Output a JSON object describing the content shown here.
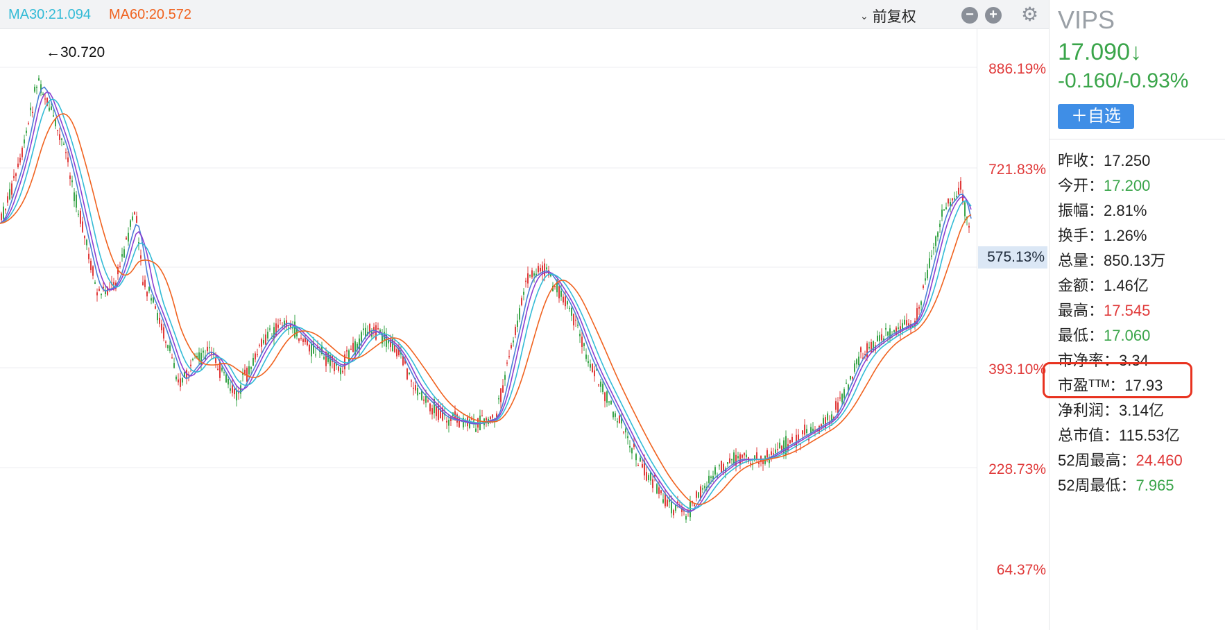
{
  "top_bar": {
    "ma30": "MA30:21.094",
    "ma60": "MA60:20.572",
    "adjust_label": "前复权",
    "chevron_icon": "chevron-down-icon",
    "buttons": [
      "minus-circle-icon",
      "plus-circle-icon",
      "minus-circle-icon",
      "gear-icon"
    ],
    "button_glyphs": {
      "minus": "−",
      "plus": "+"
    }
  },
  "chart": {
    "high_annotation": "←30.720",
    "y_axis_labels": [
      "886.19%",
      "721.83%",
      "393.10%",
      "228.73%",
      "64.37%"
    ],
    "current_tag": "575.13%",
    "colors": {
      "up": "#e03a3a",
      "down": "#3aa54a",
      "ma30": "#33bbd6",
      "ma60": "#f0621f",
      "ma_other1": "#8b3fd1",
      "ma_other2": "#4a7fd6"
    }
  },
  "sidebar": {
    "symbol": "VIPS",
    "price": "17.090↓",
    "change": "-0.160/-0.93%",
    "watch_button": "＋自选",
    "stats": [
      {
        "key": "昨收：",
        "value": "17.250",
        "tone": ""
      },
      {
        "key": "今开：",
        "value": "17.200",
        "tone": "green"
      },
      {
        "key": "振幅：",
        "value": "2.81%",
        "tone": ""
      },
      {
        "key": "换手：",
        "value": "1.26%",
        "tone": ""
      },
      {
        "key": "总量：",
        "value": "850.13万",
        "tone": ""
      },
      {
        "key": "金额：",
        "value": "1.46亿",
        "tone": ""
      },
      {
        "key": "最高：",
        "value": "17.545",
        "tone": "red"
      },
      {
        "key": "最低：",
        "value": "17.060",
        "tone": "green"
      },
      {
        "key": "市净率：",
        "value": "3.34",
        "tone": ""
      },
      {
        "key": "市盈ᵀᵀᴹ：",
        "value": "17.93",
        "tone": ""
      },
      {
        "key": "净利润：",
        "value": "3.14亿",
        "tone": ""
      },
      {
        "key": "总市值：",
        "value": "115.53亿",
        "tone": ""
      },
      {
        "key": "52周最高：",
        "value": "24.460",
        "tone": "red"
      },
      {
        "key": "52周最低：",
        "value": "7.965",
        "tone": "green"
      }
    ]
  }
}
